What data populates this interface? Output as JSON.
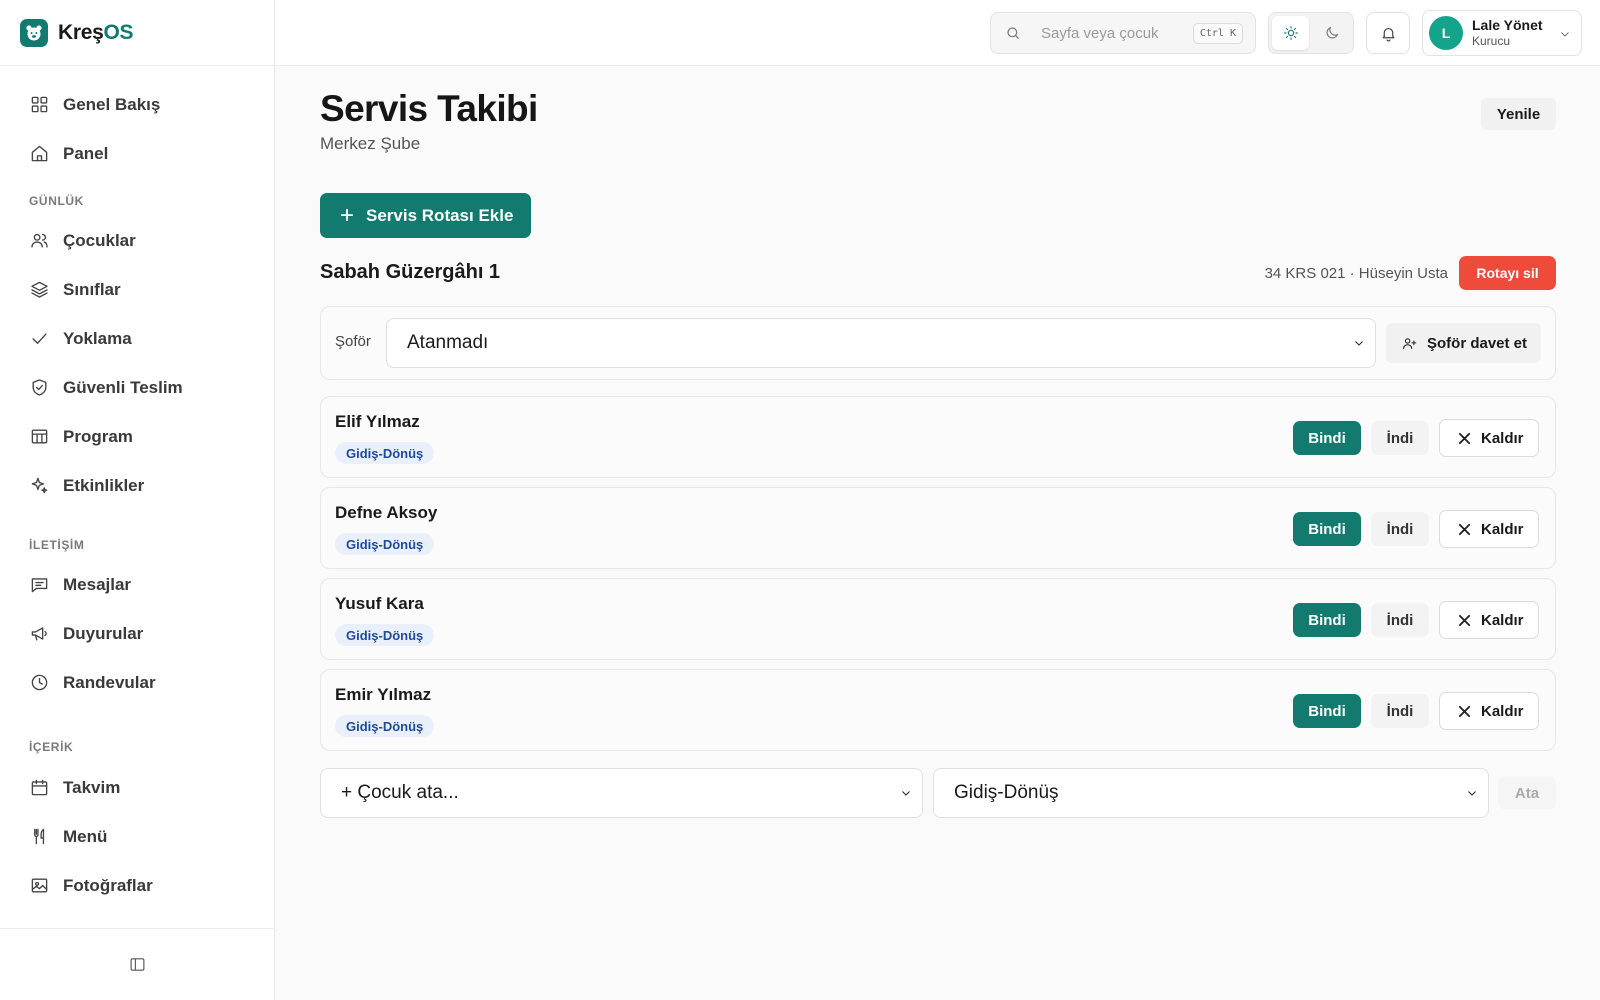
{
  "app": {
    "brand_part1": "Kreş",
    "brand_part2": "OS",
    "brand_color": "#127a6e"
  },
  "sidebar": {
    "items_top": [
      {
        "label": "Genel Bakış",
        "icon": "grid-icon"
      },
      {
        "label": "Panel",
        "icon": "home-icon"
      }
    ],
    "sections": [
      {
        "title": "GÜNLÜK",
        "items": [
          {
            "label": "Çocuklar",
            "icon": "users-icon"
          },
          {
            "label": "Sınıflar",
            "icon": "layers-icon"
          },
          {
            "label": "Yoklama",
            "icon": "check-icon"
          },
          {
            "label": "Güvenli Teslim",
            "icon": "shield-check-icon"
          },
          {
            "label": "Program",
            "icon": "table-icon"
          },
          {
            "label": "Etkinlikler",
            "icon": "sparkles-icon"
          }
        ]
      },
      {
        "title": "İLETİŞİM",
        "items": [
          {
            "label": "Mesajlar",
            "icon": "message-icon"
          },
          {
            "label": "Duyurular",
            "icon": "megaphone-icon"
          },
          {
            "label": "Randevular",
            "icon": "clock-icon"
          }
        ]
      },
      {
        "title": "İÇERİK",
        "items": [
          {
            "label": "Takvim",
            "icon": "calendar-icon"
          },
          {
            "label": "Menü",
            "icon": "utensils-icon"
          },
          {
            "label": "Fotoğraflar",
            "icon": "image-icon"
          }
        ]
      }
    ]
  },
  "topbar": {
    "search_placeholder": "Sayfa veya çocuk",
    "search_shortcut": "Ctrl K",
    "user_initial": "L",
    "user_name": "Lale Yönet",
    "user_role": "Kurucu"
  },
  "page": {
    "title": "Servis Takibi",
    "subtitle": "Merkez Şube",
    "refresh_label": "Yenile",
    "add_route_label": "Servis Rotası Ekle"
  },
  "route": {
    "name": "Sabah Güzergâhı 1",
    "meta": "34 KRS 021 · Hüseyin Usta",
    "delete_label": "Rotayı sil",
    "driver_label": "Şoför",
    "driver_value": "Atanmadı",
    "invite_driver_label": "Şoför davet et",
    "children": [
      {
        "name": "Elif Yılmaz",
        "tag": "Gidiş-Dönüş"
      },
      {
        "name": "Defne Aksoy",
        "tag": "Gidiş-Dönüş"
      },
      {
        "name": "Yusuf Kara",
        "tag": "Gidiş-Dönüş"
      },
      {
        "name": "Emir Yılmaz",
        "tag": "Gidiş-Dönüş"
      }
    ],
    "boarded_label": "Bindi",
    "got_off_label": "İndi",
    "remove_label": "Kaldır",
    "assign_child_placeholder": "+ Çocuk ata...",
    "assign_type_value": "Gidiş-Dönüş",
    "assign_label": "Ata"
  }
}
